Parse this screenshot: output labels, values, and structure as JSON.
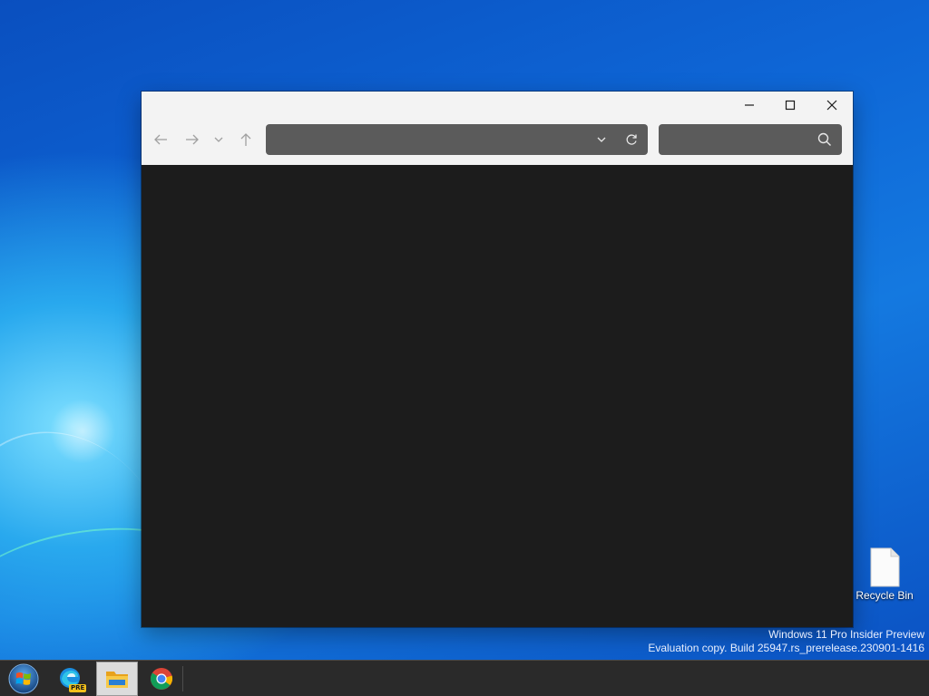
{
  "desktop": {
    "icons": [
      {
        "label": "Recycle Bin",
        "icon": "recycle-bin-icon"
      }
    ],
    "watermark": {
      "line1": "Windows 11 Pro Insider Preview",
      "line2": "Evaluation copy. Build 25947.rs_prerelease.230901-1416"
    }
  },
  "explorer_window": {
    "window_controls": [
      "minimize-icon",
      "maximize-icon",
      "close-icon"
    ],
    "navigation": [
      "back-arrow-icon",
      "forward-arrow-icon",
      "recent-locations-chevron-icon",
      "up-arrow-icon"
    ],
    "address_bar": {
      "value": "",
      "dropdown_icon": "chevron-down-icon",
      "refresh_icon": "refresh-icon"
    },
    "search_box": {
      "placeholder": "",
      "icon": "search-icon"
    },
    "content_background": "#1c1c1c",
    "toolbar_background": "#f3f3f3",
    "field_background": "#5b5b5b"
  },
  "taskbar": {
    "items": [
      {
        "name": "start-button",
        "icon": "windows-orb-icon"
      },
      {
        "name": "edge-preview",
        "icon": "edge-icon",
        "badge": "PRE"
      },
      {
        "name": "file-explorer",
        "icon": "folder-icon",
        "active": true
      },
      {
        "name": "chrome",
        "icon": "chrome-icon"
      }
    ],
    "background": "#2a2a2a"
  }
}
